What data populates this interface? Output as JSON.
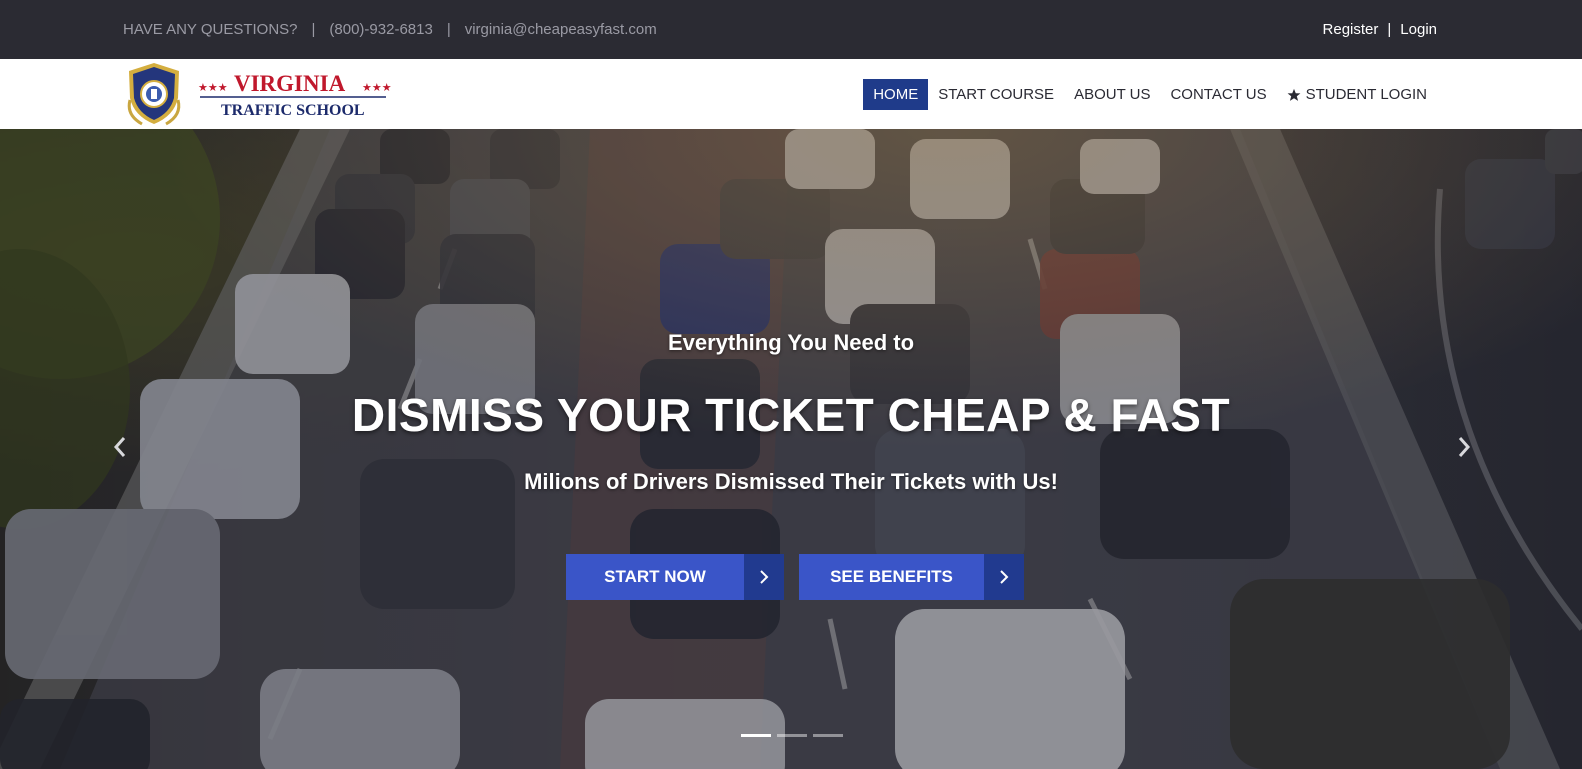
{
  "topbar": {
    "question": "HAVE ANY QUESTIONS?",
    "separator": "|",
    "phone": "(800)-932-6813",
    "email": "virginia@cheapeasyfast.com",
    "register": "Register",
    "login": "Login"
  },
  "logo": {
    "title": "VIRGINIA",
    "subtitle": "TRAFFIC SCHOOL",
    "stars": "★★★"
  },
  "nav": {
    "items": [
      {
        "label": "HOME",
        "active": true
      },
      {
        "label": "START COURSE",
        "active": false
      },
      {
        "label": "ABOUT US",
        "active": false
      },
      {
        "label": "CONTACT US",
        "active": false
      },
      {
        "label": "STUDENT LOGIN",
        "active": false,
        "icon": "star-icon"
      }
    ]
  },
  "hero": {
    "pretitle": "Everything You Need to",
    "title": "DISMISS YOUR TICKET CHEAP & FAST",
    "tagline": "Milions of Drivers Dismissed Their Tickets with Us!",
    "buttons": [
      {
        "label": "START NOW",
        "icon": "chevron-right-icon"
      },
      {
        "label": "SEE BENEFITS",
        "icon": "chevron-right-icon"
      }
    ],
    "slides": 3,
    "active_slide": 1
  },
  "colors": {
    "topbar_bg": "#2b2b33",
    "nav_active": "#1f3b8a",
    "button_primary": "#3a55c8",
    "button_arrow": "#213a8f",
    "logo_red": "#c0182c",
    "logo_navy": "#1c2a6b"
  }
}
